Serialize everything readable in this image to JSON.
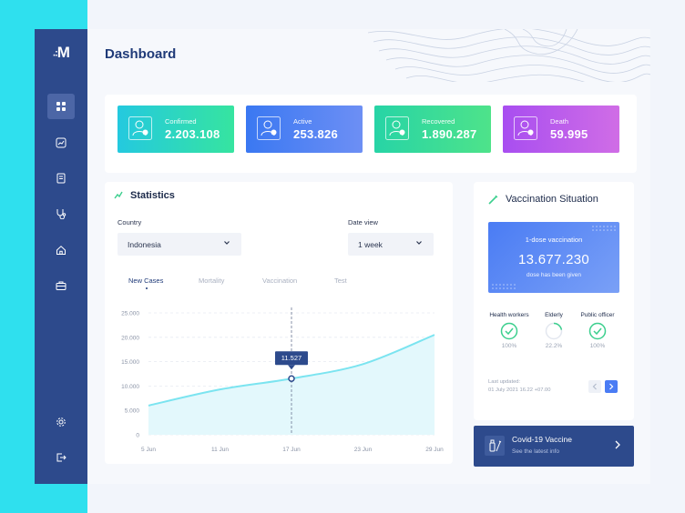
{
  "sidebar": {
    "logo": "M",
    "logo_mark": ".:",
    "items": [
      {
        "icon": "grid-icon",
        "active": true
      },
      {
        "icon": "chart-icon",
        "active": false
      },
      {
        "icon": "document-icon",
        "active": false
      },
      {
        "icon": "stethoscope-icon",
        "active": false
      },
      {
        "icon": "home-icon",
        "active": false
      },
      {
        "icon": "briefcase-icon",
        "active": false
      }
    ],
    "bottom_items": [
      {
        "icon": "gear-icon"
      },
      {
        "icon": "logout-icon"
      }
    ]
  },
  "header": {
    "title": "Dashboard"
  },
  "stats": [
    {
      "label": "Confirmed",
      "value": "2.203.108"
    },
    {
      "label": "Active",
      "value": "253.826"
    },
    {
      "label": "Recovered",
      "value": "1.890.287"
    },
    {
      "label": "Death",
      "value": "59.995"
    }
  ],
  "statistics": {
    "title": "Statistics",
    "country_label": "Country",
    "country_value": "Indonesia",
    "date_label": "Date view",
    "date_value": "1 week",
    "tabs": [
      "New Cases",
      "Mortality",
      "Vaccination",
      "Test"
    ],
    "active_tab": "New Cases"
  },
  "chart_data": {
    "type": "area",
    "x": [
      "5 Jun",
      "11 Jun",
      "17 Jun",
      "23 Jun",
      "29 Jun"
    ],
    "y_ticks": [
      "25.000",
      "20.000",
      "15.000",
      "10.000",
      "5.000",
      "0"
    ],
    "ylim": [
      0,
      25000
    ],
    "series": [
      {
        "values": [
          6000,
          9300,
          11527,
          14500,
          20500
        ]
      }
    ],
    "highlight": {
      "x": "17 Jun",
      "label": "11.527"
    },
    "grid": true,
    "colors": {
      "line": "#7be4f0",
      "fill": "#e3f8fc",
      "tooltip": "#2d4a8c"
    }
  },
  "vaccination": {
    "title": "Vaccination Situation",
    "dose_label": "1-dose vaccination",
    "dose_value": "13.677.230",
    "dose_sub": "dose has been given",
    "groups": [
      {
        "label": "Health workers",
        "pct": "100%",
        "done": true,
        "fraction": 1.0
      },
      {
        "label": "Elderly",
        "pct": "22.2%",
        "done": false,
        "fraction": 0.222
      },
      {
        "label": "Public officer",
        "pct": "100%",
        "done": true,
        "fraction": 1.0
      }
    ],
    "updated_label": "Last updated:",
    "updated_value": "01 July 2021 16.22 +07.00"
  },
  "vaccine_card": {
    "title": "Covid-19 Vaccine",
    "subtitle": "See the latest info"
  },
  "colors": {
    "navy": "#2d4a8c",
    "cyan": "#2fe0ee",
    "green": "#3ccf8e"
  }
}
